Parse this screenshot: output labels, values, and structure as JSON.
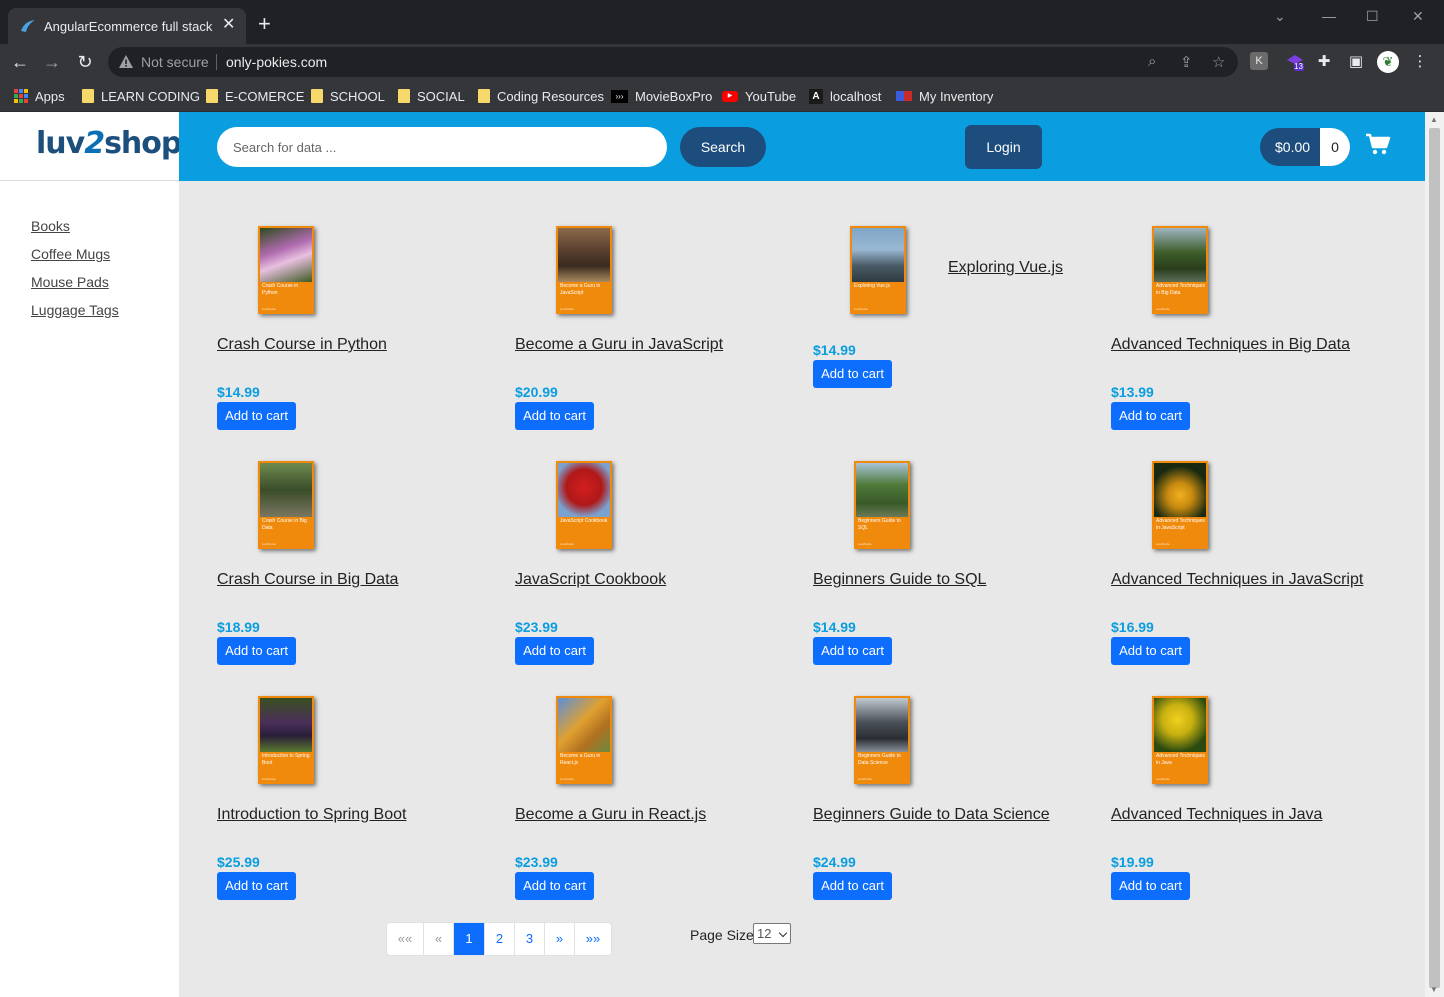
{
  "browser": {
    "tab_title": "AngularEcommerce full stack",
    "new_tab": "+",
    "security_label": "Not secure",
    "url": "only-pokies.com",
    "extension_badge": "13",
    "bookmarks": [
      {
        "label": "Apps",
        "icon": "apps-grid-icon"
      },
      {
        "label": "LEARN CODING",
        "icon": "folder-icon"
      },
      {
        "label": "E-COMERCE",
        "icon": "folder-icon"
      },
      {
        "label": "SCHOOL",
        "icon": "folder-icon"
      },
      {
        "label": "SOCIAL",
        "icon": "folder-icon"
      },
      {
        "label": "Coding Resources",
        "icon": "folder-icon"
      },
      {
        "label": "MovieBoxPro",
        "icon": "moviebox-icon"
      },
      {
        "label": "YouTube",
        "icon": "youtube-icon"
      },
      {
        "label": "localhost",
        "icon": "angular-icon"
      },
      {
        "label": "My Inventory",
        "icon": "inventory-icon"
      }
    ]
  },
  "brand": {
    "logo_part1": "luv",
    "logo_part2": "2",
    "logo_part3": "shop"
  },
  "sidebar": {
    "items": [
      {
        "label": "Books"
      },
      {
        "label": "Coffee Mugs"
      },
      {
        "label": "Mouse Pads"
      },
      {
        "label": "Luggage Tags"
      }
    ]
  },
  "header": {
    "search_placeholder": "Search for data ...",
    "search_button": "Search",
    "login_button": "Login",
    "cart_total": "$0.00",
    "cart_count": "0"
  },
  "products": [
    {
      "name": "Crash Course in Python",
      "price": "$14.99",
      "cover_text": "Crash Course in Python",
      "cover_author": "Luv2Code",
      "button": "Add to cart"
    },
    {
      "name": "Become a Guru in JavaScript",
      "price": "$20.99",
      "cover_text": "Become a Guru in JavaScript",
      "cover_author": "Luv2Code",
      "button": "Add to cart"
    },
    {
      "name": "Exploring Vue.js",
      "price": "$14.99",
      "cover_text": "Exploring Vue.js",
      "cover_author": "Luv2Code",
      "button": "Add to cart"
    },
    {
      "name": "Advanced Techniques in Big Data",
      "price": "$13.99",
      "cover_text": "Advanced Techniques in Big Data",
      "cover_author": "Luv2Code",
      "button": "Add to cart"
    },
    {
      "name": "Crash Course in Big Data",
      "price": "$18.99",
      "cover_text": "Crash Course in Big Data",
      "cover_author": "Luv2Code",
      "button": "Add to cart"
    },
    {
      "name": "JavaScript Cookbook",
      "price": "$23.99",
      "cover_text": "JavaScript Cookbook",
      "cover_author": "Luv2Code",
      "button": "Add to cart"
    },
    {
      "name": "Beginners Guide to SQL",
      "price": "$14.99",
      "cover_text": "Beginners Guide to SQL",
      "cover_author": "Luv2Code",
      "button": "Add to cart"
    },
    {
      "name": "Advanced Techniques in JavaScript",
      "price": "$16.99",
      "cover_text": "Advanced Techniques in JavaScript",
      "cover_author": "Luv2Code",
      "button": "Add to cart"
    },
    {
      "name": "Introduction to Spring Boot",
      "price": "$25.99",
      "cover_text": "Introduction to Spring Boot",
      "cover_author": "Luv2Code",
      "button": "Add to cart"
    },
    {
      "name": "Become a Guru in React.js",
      "price": "$23.99",
      "cover_text": "Become a Guru in React.js",
      "cover_author": "Luv2Code",
      "button": "Add to cart"
    },
    {
      "name": "Beginners Guide to Data Science",
      "price": "$24.99",
      "cover_text": "Beginners Guide to Data Science",
      "cover_author": "Luv2Code",
      "button": "Add to cart"
    },
    {
      "name": "Advanced Techniques in Java",
      "price": "$19.99",
      "cover_text": "Advanced Techniques in Java",
      "cover_author": "Luv2Code",
      "button": "Add to cart"
    }
  ],
  "pagination": {
    "first": "««",
    "prev": "«",
    "pages": [
      "1",
      "2",
      "3"
    ],
    "current_page": "1",
    "next": "»",
    "last": "»»",
    "page_size_label": "Page Size",
    "page_size": "12"
  },
  "colors": {
    "header_bg": "#0a9ee0",
    "dark_button": "#1c4d7c",
    "add_button": "#0d6efd",
    "price": "#0a9ee0",
    "cover_orange": "#f08a0c"
  }
}
